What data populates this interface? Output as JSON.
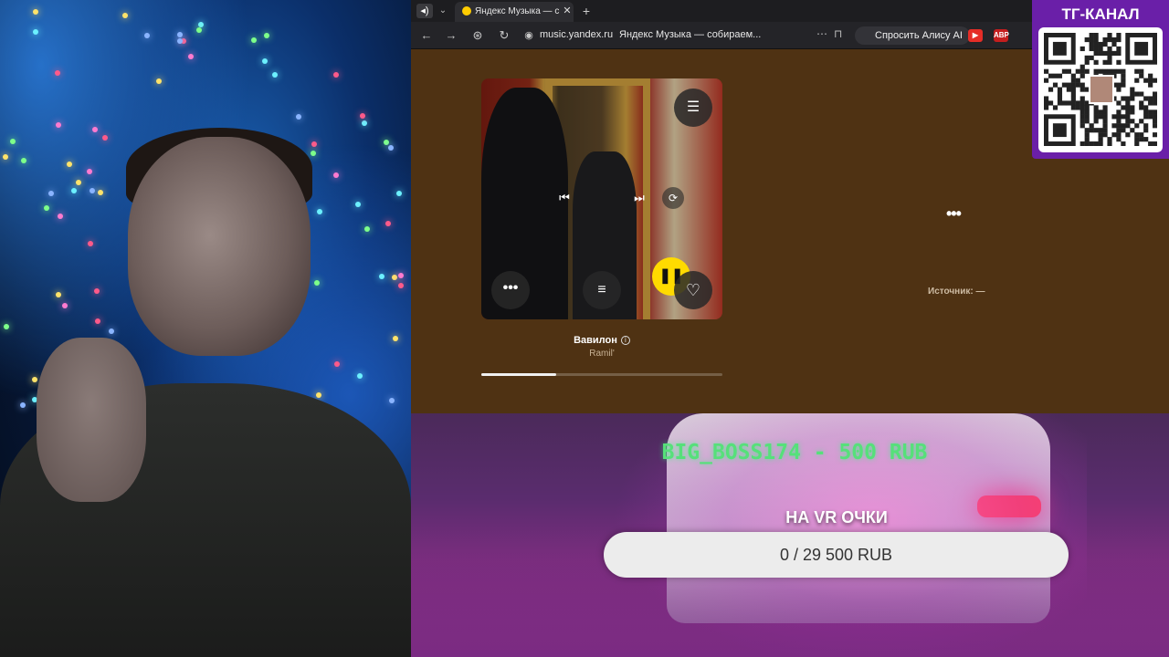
{
  "browser": {
    "tab": {
      "title": "Яндекс Музыка — с",
      "close_icon": "✕",
      "new_tab_icon": "+"
    },
    "address": {
      "url": "music.yandex.ru",
      "page_title": "Яндекс Музыка — собираем...",
      "ai_button": "Спросить Алису AI"
    },
    "extensions": [
      "youtube-icon",
      "adblock-icon"
    ],
    "extension_label": "ABP"
  },
  "player": {
    "track_title": "Вавилон",
    "artist": "Ramil'",
    "progress": 0.31,
    "info_icon": "i",
    "source_label": "Источник: —",
    "more_label": "•••"
  },
  "donation": {
    "title": "BIG_BOSS174 - 500 RUB",
    "goal_title": "НА VR ОЧКИ",
    "progress_text": "0 / 29 500 RUB",
    "progress_value": 0,
    "progress_target": 29500,
    "accent_color": "#56e07a"
  },
  "channel": {
    "label": "ТГ-КАНАЛ"
  },
  "colors": {
    "page_bg": "#4f3213",
    "play_button": "#ffdb00",
    "qr_frame": "#6a1fa8"
  }
}
